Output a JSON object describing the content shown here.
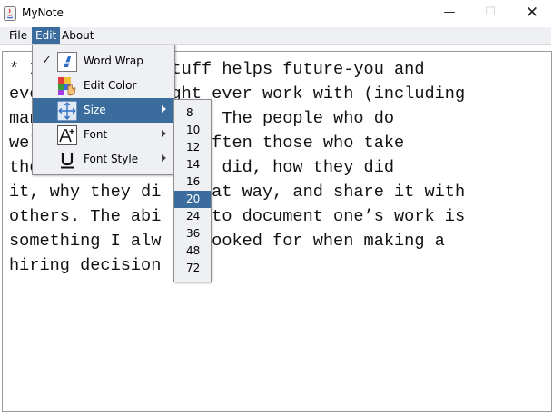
{
  "window": {
    "title": "MyNote",
    "minimize_glyph": "—",
    "maximize_glyph": "☐",
    "close_glyph": "✕"
  },
  "menubar": {
    "file": "File",
    "edit": "Edit",
    "about": "About"
  },
  "editor": {
    "lines": [
      "* I        our stuff helps future-you and",
      "eve        ou might ever work with (including",
      "man        or boss). The people who do",
      "wel        ers are often those who take",
      "the        what they did, how they did",
      "it, why they di   that way, and share it with",
      "others. The abi     to document one’s work is",
      "something I alw    looked for when making a",
      "hiring decision"
    ]
  },
  "edit_menu": {
    "items": [
      {
        "label": "Word Wrap",
        "checked": true,
        "check_glyph": "✓",
        "icon": "word-wrap-icon",
        "has_submenu": false
      },
      {
        "label": "Edit Color",
        "icon": "edit-color-icon",
        "has_submenu": false
      },
      {
        "label": "Size",
        "icon": "size-icon",
        "has_submenu": true,
        "selected": true
      },
      {
        "label": "Font",
        "icon": "font-icon",
        "has_submenu": true
      },
      {
        "label": "Font Style",
        "icon": "font-style-icon",
        "has_submenu": true
      }
    ]
  },
  "size_menu": {
    "options": [
      "8",
      "10",
      "12",
      "14",
      "16",
      "20",
      "24",
      "36",
      "48",
      "72"
    ],
    "selected": "20"
  },
  "colors": {
    "accent": "#3a6d9e",
    "menu_bg": "#eef0f3"
  }
}
